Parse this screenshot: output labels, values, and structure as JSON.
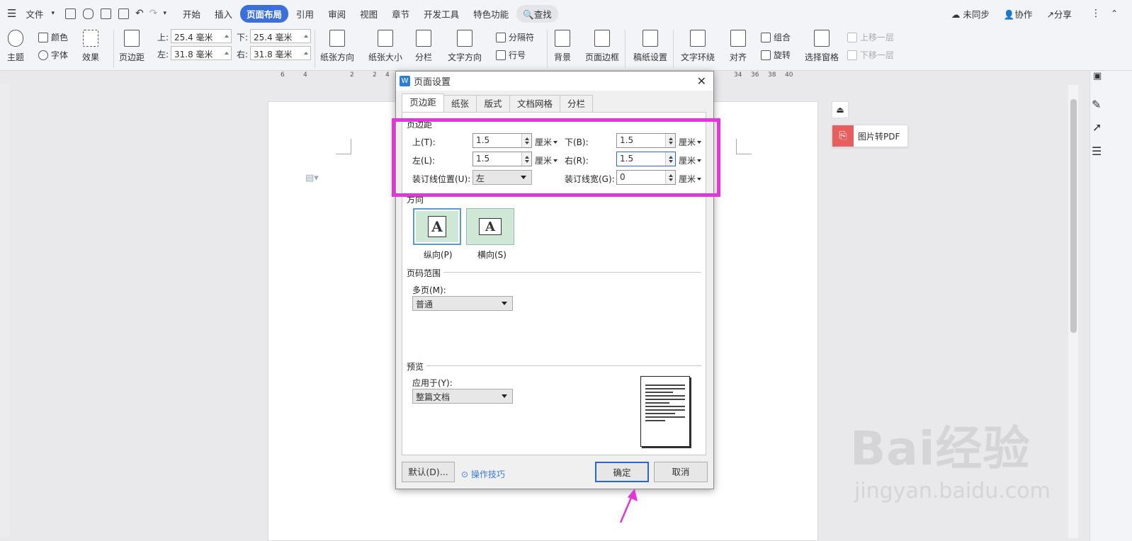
{
  "menubar": {
    "file": "文件",
    "tabs": [
      "开始",
      "插入",
      "页面布局",
      "引用",
      "审阅",
      "视图",
      "章节",
      "开发工具",
      "特色功能"
    ],
    "active_tab": "页面布局",
    "search": "查找",
    "sync": "未同步",
    "collab": "协作",
    "share": "分享"
  },
  "ribbon": {
    "theme": "主题",
    "color": "颜色",
    "font": "字体",
    "effect": "效果",
    "margins": "页边距",
    "top_lbl": "上:",
    "top_val": "25.4 毫米",
    "bottom_lbl": "下:",
    "bottom_val": "25.4 毫米",
    "left_lbl": "左:",
    "left_val": "31.8 毫米",
    "right_lbl": "右:",
    "right_val": "31.8 毫米",
    "orientation": "纸张方向",
    "size": "纸张大小",
    "columns": "分栏",
    "text_dir": "文字方向",
    "separator": "分隔符",
    "line_no": "行号",
    "background": "背景",
    "page_border": "页面边框",
    "manuscript": "稿纸设置",
    "wrap": "文字环绕",
    "align": "对齐",
    "group": "组合",
    "rotate": "旋转",
    "selection_pane": "选择窗格",
    "bring_forward": "上移一层",
    "send_backward": "下移一层"
  },
  "ruler": {
    "labels": [
      "6",
      "4",
      "2",
      "2",
      "4",
      "34",
      "36",
      "38",
      "40"
    ]
  },
  "side": {
    "pdf_label": "图片转PDF"
  },
  "watermark": {
    "line1": "Bai经验",
    "line2": "jingyan.baidu.com"
  },
  "dialog": {
    "title": "页面设置",
    "tabs": [
      "页边距",
      "纸张",
      "版式",
      "文档网格",
      "分栏"
    ],
    "margins_group": "页边距",
    "top": {
      "label": "上(T):",
      "value": "1.5",
      "unit": "厘米"
    },
    "bottom": {
      "label": "下(B):",
      "value": "1.5",
      "unit": "厘米"
    },
    "left": {
      "label": "左(L):",
      "value": "1.5",
      "unit": "厘米"
    },
    "right": {
      "label": "右(R):",
      "value": "1.5",
      "unit": "厘米"
    },
    "gutter_pos": {
      "label": "装订线位置(U):",
      "value": "左"
    },
    "gutter_width": {
      "label": "装订线宽(G):",
      "value": "0",
      "unit": "厘米"
    },
    "orientation_group": "方向",
    "portrait": "纵向(P)",
    "landscape": "横向(S)",
    "page_range_group": "页码范围",
    "multi_pages_label": "多页(M):",
    "multi_pages_value": "普通",
    "preview_group": "预览",
    "apply_label": "应用于(Y):",
    "apply_value": "整篇文档",
    "default_btn": "默认(D)...",
    "tips": "操作技巧",
    "ok": "确定",
    "cancel": "取消"
  },
  "colors": {
    "accent": "#3b6fd9",
    "highlight": "#e436d8",
    "pdf": "#e85e5e"
  }
}
